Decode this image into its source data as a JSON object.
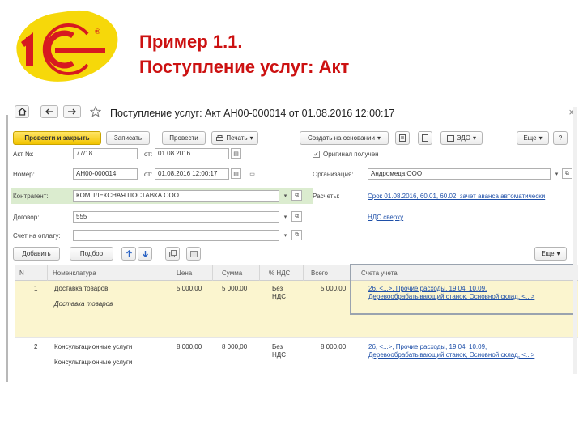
{
  "slide": {
    "logo_text": "1С",
    "title_line1": "Пример 1.1.",
    "title_line2": "Поступление услуг: Акт"
  },
  "window": {
    "title": "Поступление услуг: Акт АН00-000014 от 01.08.2016 12:00:17",
    "close": "×"
  },
  "toolbar": {
    "post_close": "Провести и закрыть",
    "save": "Записать",
    "post": "Провести",
    "print": "Печать",
    "create_based": "Создать на основании",
    "edo": "ЭДО",
    "more": "Еще",
    "help": "?"
  },
  "form": {
    "act_label": "Акт №:",
    "act_value": "77/18",
    "from1_label": "от:",
    "from1_value": "01.08.2016",
    "original_label": "Оригинал получен",
    "original_checked": true,
    "number_label": "Номер:",
    "number_value": "АН00-000014",
    "from2_label": "от:",
    "from2_value": "01.08.2016 12:00:17",
    "org_label": "Организация:",
    "org_value": "Андромеда ООО",
    "contractor_label": "Контрагент:",
    "contractor_value": "КОМПЛЕКСНАЯ ПОСТАВКА ООО",
    "settlements_label": "Расчеты:",
    "settlements_link": "Срок 01.08.2016, 60.01, 60.02, зачет аванса автоматически",
    "contract_label": "Договор:",
    "contract_value": "555",
    "vat_link": "НДС сверху",
    "invoice_label": "Счет на оплату:",
    "invoice_value": ""
  },
  "table_toolbar": {
    "add": "Добавить",
    "select": "Подбор",
    "more": "Еще"
  },
  "table": {
    "columns": [
      "N",
      "Номенклатура",
      "Цена",
      "Сумма",
      "% НДС",
      "Всего",
      "Счета учета"
    ],
    "rows": [
      {
        "n": "1",
        "name": "Доставка товаров",
        "content": "Доставка товаров",
        "price": "5 000,00",
        "sum": "5 000,00",
        "vat1": "Без",
        "vat2": "НДС",
        "total": "5 000,00",
        "acc1": "26, <...>, Прочие расходы, 19.04, 10.09,",
        "acc2": "Деревообрабатывающий станок, Основной склад, <...>"
      },
      {
        "n": "2",
        "name": "Консультационные услуги",
        "content": "Консультационные услуги",
        "price": "8 000,00",
        "sum": "8 000,00",
        "vat1": "Без",
        "vat2": "НДС",
        "total": "8 000,00",
        "acc1": "26, <...>, Прочие расходы, 19.04, 10.09,",
        "acc2": "Деревообрабатывающий станок, Основной склад, <...>"
      }
    ]
  },
  "colors": {
    "title_red": "#cc1111",
    "logo_yellow": "#f6d80a",
    "logo_red": "#d71920",
    "primary_button": "#f2c400",
    "contractor_row": "#dbeccf",
    "selected_row": "#fbf5cf",
    "link_blue": "#1e4fa8"
  },
  "icons": [
    "home-icon",
    "back-icon",
    "forward-icon",
    "star-icon",
    "print-icon",
    "document-icon",
    "search-icon",
    "calendar-icon",
    "open-icon",
    "arrow-up-icon",
    "arrow-down-icon",
    "copy-icon",
    "check-icon"
  ]
}
